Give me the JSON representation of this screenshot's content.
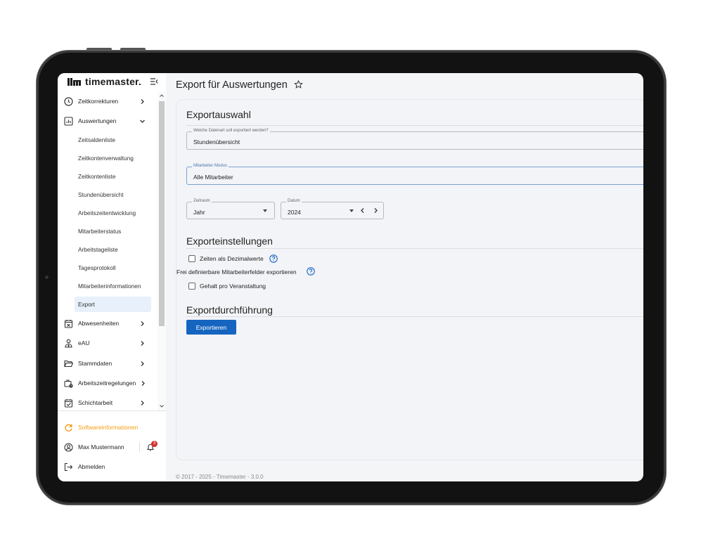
{
  "app": {
    "logo_text": "timemaster."
  },
  "sidebar": {
    "items": [
      {
        "label": "Zeitkorrekturen"
      },
      {
        "label": "Auswertungen"
      },
      {
        "label": "Abwesenheiten"
      },
      {
        "label": "eAU"
      },
      {
        "label": "Stammdaten"
      },
      {
        "label": "Arbeitszeitregelungen"
      },
      {
        "label": "Schichtarbeit"
      }
    ],
    "sub_items": [
      {
        "label": "Zeitsaldenliste"
      },
      {
        "label": "Zeitkontenverwaltung"
      },
      {
        "label": "Zeitkontenliste"
      },
      {
        "label": "Stundenübersicht"
      },
      {
        "label": "Arbeitszeitentwicklung"
      },
      {
        "label": "Mitarbeiterstatus"
      },
      {
        "label": "Arbeitstageliste"
      },
      {
        "label": "Tagesprotokoll"
      },
      {
        "label": "Mitarbeiterinformationen"
      },
      {
        "label": "Export"
      }
    ],
    "footer": {
      "software_info": "Softwareinformationen",
      "user_name": "Max Mustermann",
      "notification_count": "3",
      "logout": "Abmelden"
    }
  },
  "main": {
    "title": "Export für Auswertungen",
    "section_auswahl": "Exportauswahl",
    "datenart": {
      "legend": "Welche Datenart soll exportiert werden?",
      "value": "Stundenübersicht"
    },
    "modus": {
      "legend": "Mitarbeiter Modus",
      "value": "Alle Mitarbeiter"
    },
    "zeitraum": {
      "legend": "Zeitraum",
      "value": "Jahr"
    },
    "datum": {
      "legend": "Datum",
      "value": "2024"
    },
    "section_einstellungen": "Exporteinstellungen",
    "opt_dezimal": "Zeiten als Dezimalwerte",
    "opt_frei": "Frei definierbare Mitarbeiterfelder exportieren",
    "opt_gehalt": "Gehalt pro Veranstaltung",
    "section_durchfuehrung": "Exportdurchführung",
    "export_button": "Exportieren",
    "footer": "© 2017 - 2025 - Timemaster - 3.0.0"
  },
  "colors": {
    "accent": "#1565c0",
    "software_info": "#f39c12",
    "badge": "#d32f2f"
  }
}
